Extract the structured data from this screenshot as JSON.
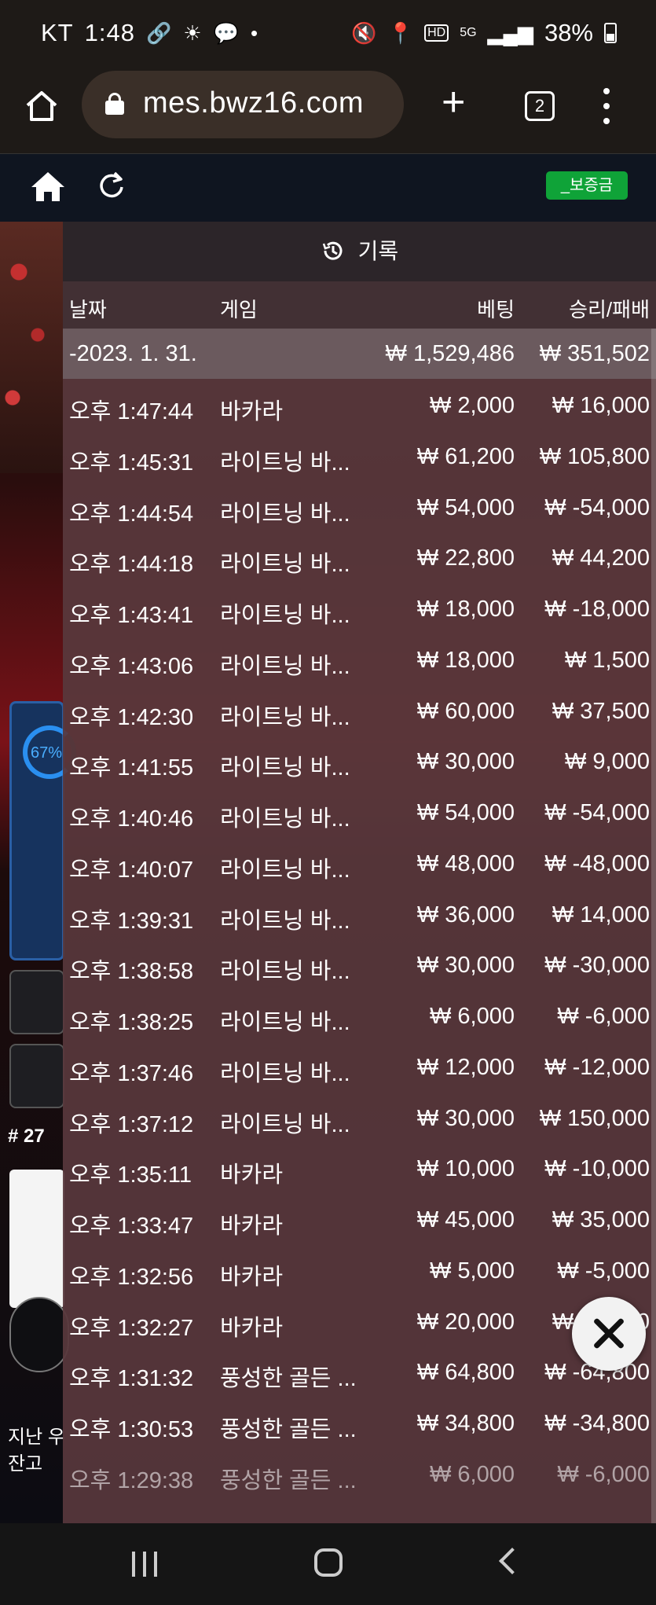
{
  "status_bar": {
    "carrier": "KT",
    "time": "1:48",
    "battery": "38%",
    "icons": [
      "link-icon",
      "brightness-icon",
      "talk-icon",
      "dot-icon",
      "mute-icon",
      "location-icon",
      "hd-icon",
      "5g-icon",
      "signal-icon",
      "battery-icon"
    ]
  },
  "browser": {
    "url": "mes.bwz16.com",
    "tab_count": "2"
  },
  "site": {
    "deposit_label": "_보증금"
  },
  "background": {
    "progress": "67%",
    "round": "# 27",
    "balance_line1": "지난 우",
    "balance_line2": "잔고"
  },
  "history": {
    "title": "기록",
    "columns": {
      "date": "날짜",
      "game": "게임",
      "bet": "베팅",
      "win_loss": "승리/패배"
    },
    "date_group": {
      "date": "-2023. 1. 31.",
      "bet_total": "₩ 1,529,486",
      "win_total": "₩ 351,502"
    },
    "rows": [
      {
        "time": "오후 1:47:44",
        "game": "바카라",
        "bet": "₩ 2,000",
        "win": "₩ 16,000"
      },
      {
        "time": "오후 1:45:31",
        "game": "라이트닝 바...",
        "bet": "₩ 61,200",
        "win": "₩ 105,800"
      },
      {
        "time": "오후 1:44:54",
        "game": "라이트닝 바...",
        "bet": "₩ 54,000",
        "win": "₩ -54,000"
      },
      {
        "time": "오후 1:44:18",
        "game": "라이트닝 바...",
        "bet": "₩ 22,800",
        "win": "₩ 44,200"
      },
      {
        "time": "오후 1:43:41",
        "game": "라이트닝 바...",
        "bet": "₩ 18,000",
        "win": "₩ -18,000"
      },
      {
        "time": "오후 1:43:06",
        "game": "라이트닝 바...",
        "bet": "₩ 18,000",
        "win": "₩ 1,500"
      },
      {
        "time": "오후 1:42:30",
        "game": "라이트닝 바...",
        "bet": "₩ 60,000",
        "win": "₩ 37,500"
      },
      {
        "time": "오후 1:41:55",
        "game": "라이트닝 바...",
        "bet": "₩ 30,000",
        "win": "₩ 9,000"
      },
      {
        "time": "오후 1:40:46",
        "game": "라이트닝 바...",
        "bet": "₩ 54,000",
        "win": "₩ -54,000"
      },
      {
        "time": "오후 1:40:07",
        "game": "라이트닝 바...",
        "bet": "₩ 48,000",
        "win": "₩ -48,000"
      },
      {
        "time": "오후 1:39:31",
        "game": "라이트닝 바...",
        "bet": "₩ 36,000",
        "win": "₩ 14,000"
      },
      {
        "time": "오후 1:38:58",
        "game": "라이트닝 바...",
        "bet": "₩ 30,000",
        "win": "₩ -30,000"
      },
      {
        "time": "오후 1:38:25",
        "game": "라이트닝 바...",
        "bet": "₩ 6,000",
        "win": "₩ -6,000"
      },
      {
        "time": "오후 1:37:46",
        "game": "라이트닝 바...",
        "bet": "₩ 12,000",
        "win": "₩ -12,000"
      },
      {
        "time": "오후 1:37:12",
        "game": "라이트닝 바...",
        "bet": "₩ 30,000",
        "win": "₩ 150,000"
      },
      {
        "time": "오후 1:35:11",
        "game": "바카라",
        "bet": "₩ 10,000",
        "win": "₩ -10,000"
      },
      {
        "time": "오후 1:33:47",
        "game": "바카라",
        "bet": "₩ 45,000",
        "win": "₩ 35,000"
      },
      {
        "time": "오후 1:32:56",
        "game": "바카라",
        "bet": "₩ 5,000",
        "win": "₩ -5,000"
      },
      {
        "time": "오후 1:32:27",
        "game": "바카라",
        "bet": "₩ 20,000",
        "win": "₩ 15,000"
      },
      {
        "time": "오후 1:31:32",
        "game": "풍성한 골든 ...",
        "bet": "₩ 64,800",
        "win": "₩ -64,800"
      },
      {
        "time": "오후 1:30:53",
        "game": "풍성한 골든 ...",
        "bet": "₩ 34,800",
        "win": "₩ -34,800"
      },
      {
        "time": "오후 1:29:38",
        "game": "풍성한 골든 ...",
        "bet": "₩ 6,000",
        "win": "₩ -6,000"
      }
    ]
  }
}
